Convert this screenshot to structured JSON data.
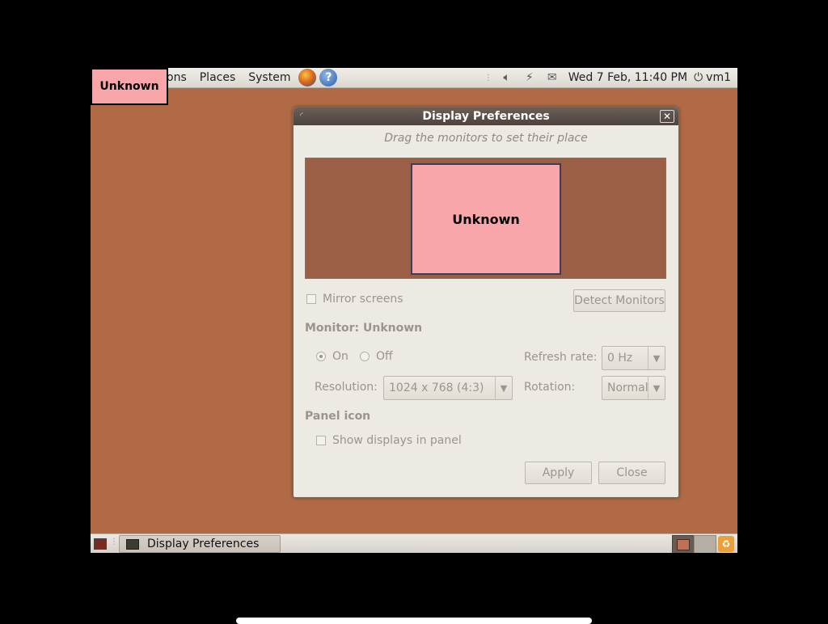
{
  "top_panel": {
    "menus": [
      "ons",
      "Places",
      "System"
    ],
    "clock": "Wed  7 Feb, 11:40 PM",
    "user": "vm1"
  },
  "monitor_label": "Unknown",
  "dialog": {
    "title": "Display Preferences",
    "hint": "Drag the monitors to set their place",
    "monitor_name": "Unknown",
    "mirror_label": "Mirror screens",
    "detect_button": "Detect Monitors",
    "monitor_heading": "Monitor: Unknown",
    "on_label": "On",
    "off_label": "Off",
    "refresh_label": "Refresh rate:",
    "refresh_value": "0 Hz",
    "resolution_label": "Resolution:",
    "resolution_value": "1024 x 768 (4:3)",
    "rotation_label": "Rotation:",
    "rotation_value": "Normal",
    "panel_heading": "Panel icon",
    "show_displays_label": "Show displays in panel",
    "apply_button": "Apply",
    "close_button": "Close"
  },
  "taskbar": {
    "task_label": "Display Preferences"
  },
  "colors": {
    "desktop": "#b06a45",
    "monitor": "#f8a6a9",
    "monitor_area": "#9b5f45"
  }
}
